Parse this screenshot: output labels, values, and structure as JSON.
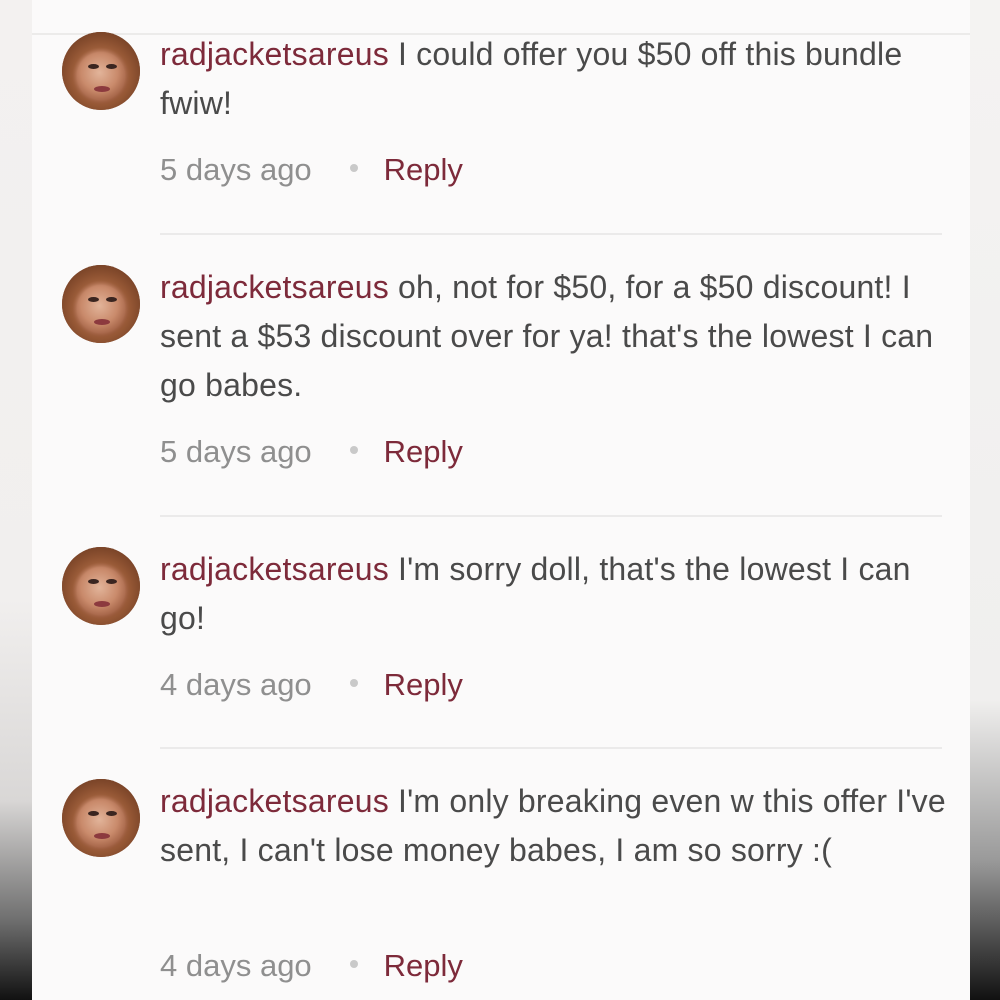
{
  "comments": [
    {
      "username": "radjacketsareus",
      "text": " I could offer you $50 off this bundle fwiw!",
      "time": "5 days ago",
      "reply_label": "Reply"
    },
    {
      "username": "radjacketsareus",
      "text": " oh, not for $50, for a $50 discount! I sent a $53 discount over for ya! that's the lowest I can go babes.",
      "time": "5 days ago",
      "reply_label": "Reply"
    },
    {
      "username": "radjacketsareus",
      "text": " I'm sorry doll, that's the lowest I can go!",
      "time": "4 days ago",
      "reply_label": "Reply"
    },
    {
      "username": "radjacketsareus",
      "text": " I'm only breaking even w this offer I've sent, I can't lose money babes, I am so sorry :(",
      "time": "4 days ago",
      "reply_label": "Reply"
    }
  ],
  "colors": {
    "username": "#7d2a3a",
    "body_text": "#4a4a4a",
    "meta_text": "#8f8f8f",
    "panel_bg": "#fbfafa"
  },
  "icons": {
    "separator": "dot-icon",
    "avatar": "user-avatar"
  }
}
